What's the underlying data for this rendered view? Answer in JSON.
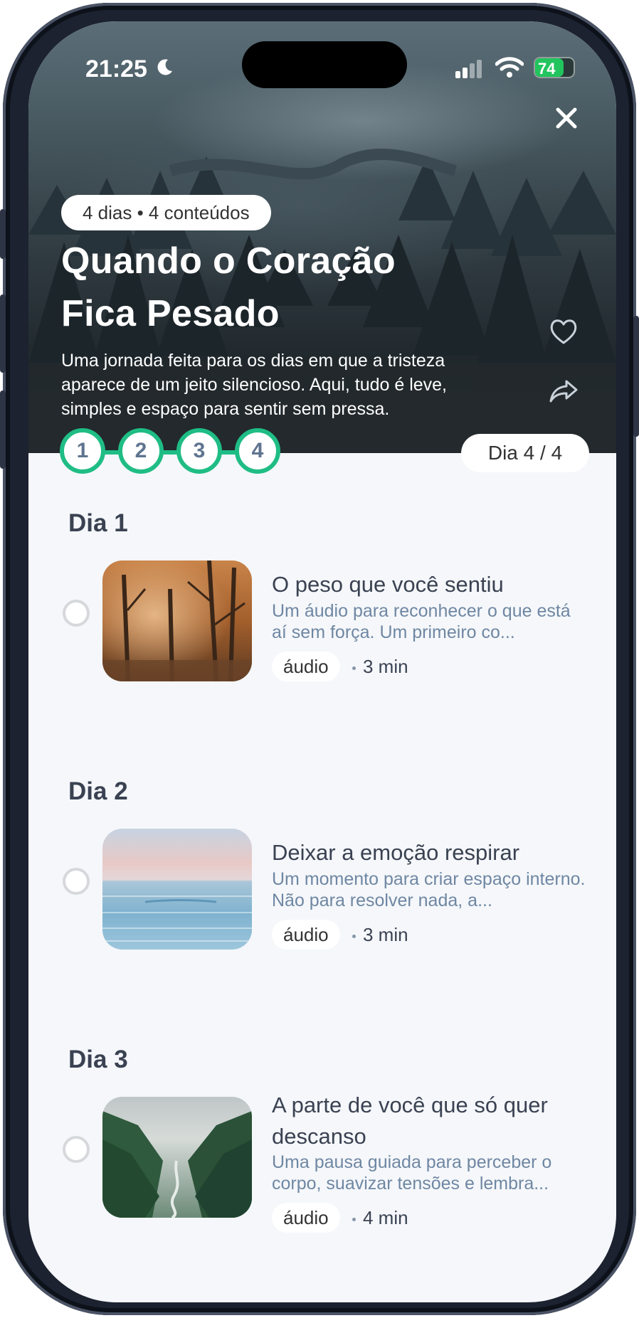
{
  "status": {
    "time": "21:25",
    "battery": "74"
  },
  "hero": {
    "meta": "4 dias • 4 conteúdos",
    "title": "Quando o Coração Fica Pesado",
    "description": " Uma jornada feita para os dias em que a tristeza aparece de um jeito silencioso. Aqui, tudo é leve, simples e espaço para sentir sem pressa."
  },
  "progress": {
    "steps": [
      "1",
      "2",
      "3",
      "4"
    ],
    "badge": "Dia 4 / 4"
  },
  "days": [
    {
      "label": "Dia 1",
      "title": "O peso que você sentiu",
      "description": "Um áudio para reconhecer o que está aí sem força. Um primeiro co...",
      "type": "áudio",
      "duration": "3 min",
      "thumb": "autumn-forest"
    },
    {
      "label": "Dia 2",
      "title": "Deixar a emoção respirar",
      "description": "Um momento para criar espaço interno. Não para resolver nada, a...",
      "type": "áudio",
      "duration": "3 min",
      "thumb": "calm-sea"
    },
    {
      "label": "Dia 3",
      "title": "A parte de você que só quer descanso",
      "description": "Uma pausa guiada para perceber o corpo, suavizar tensões e lembra...",
      "type": "áudio",
      "duration": "4 min",
      "thumb": "misty-valley"
    }
  ],
  "colors": {
    "accent": "#1fbd85",
    "text": "#3a4252",
    "muted": "#6f87a3",
    "background": "#f5f7fa"
  },
  "icons": [
    "moon-icon",
    "signal-icon",
    "wifi-icon",
    "battery-icon",
    "close-icon",
    "heart-icon",
    "share-icon",
    "radio-icon"
  ]
}
